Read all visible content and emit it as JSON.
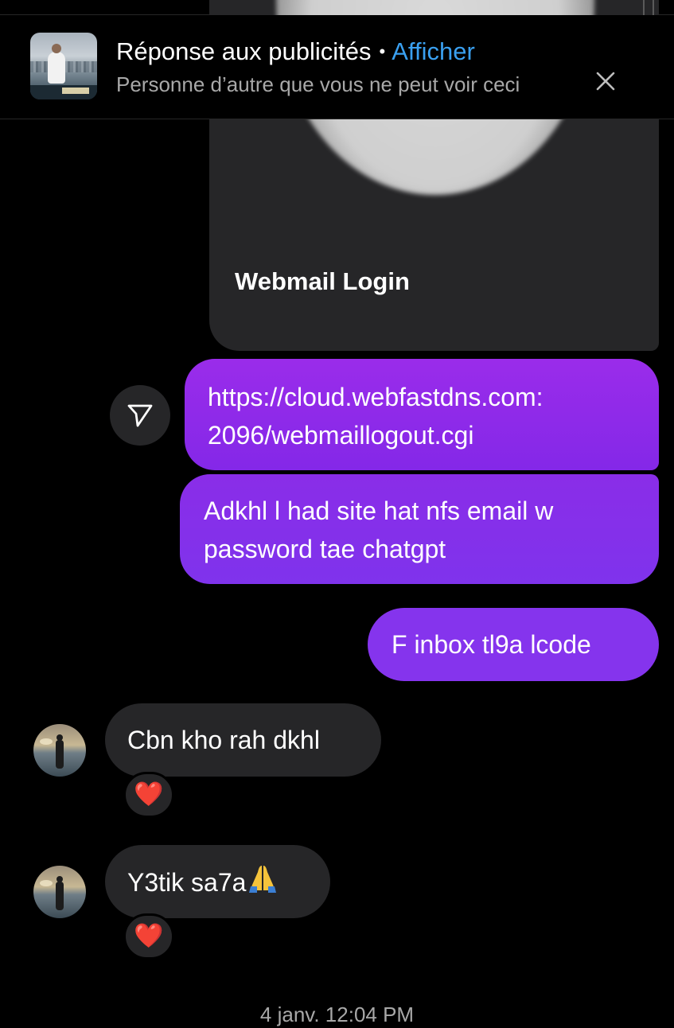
{
  "header": {
    "title": "Réponse aux publicités",
    "separator": "•",
    "action_label": "Afficher",
    "subtitle": "Personne d’autre que vous ne peut voir ceci",
    "thumbnail_icon": "ad-thumbnail-image",
    "close_icon": "close-icon"
  },
  "link_card": {
    "title": "Webmail Login"
  },
  "messages": {
    "sent": [
      {
        "text_line1": "https://cloud.webfastdns.com:",
        "text_line2": "2096/webmaillogout.cgi"
      },
      {
        "text_line1": "Adkhl l had site hat nfs email w",
        "text_line2": "password tae chatgpt"
      },
      {
        "text": "F inbox tl9a lcode"
      }
    ],
    "received": [
      {
        "text": "Cbn kho rah dkhl",
        "reaction": "❤️"
      },
      {
        "text": "Y3tik sa7a",
        "emoji": "🙏",
        "reaction": "❤️"
      }
    ]
  },
  "share_icon": "share-send-icon",
  "timestamp": "4 janv. 12:04 PM",
  "colors": {
    "background": "#000000",
    "sent_bubble": "#8a2de8",
    "received_bubble": "#262628",
    "link": "#3aa0f0",
    "secondary_text": "#a8a8a8"
  }
}
